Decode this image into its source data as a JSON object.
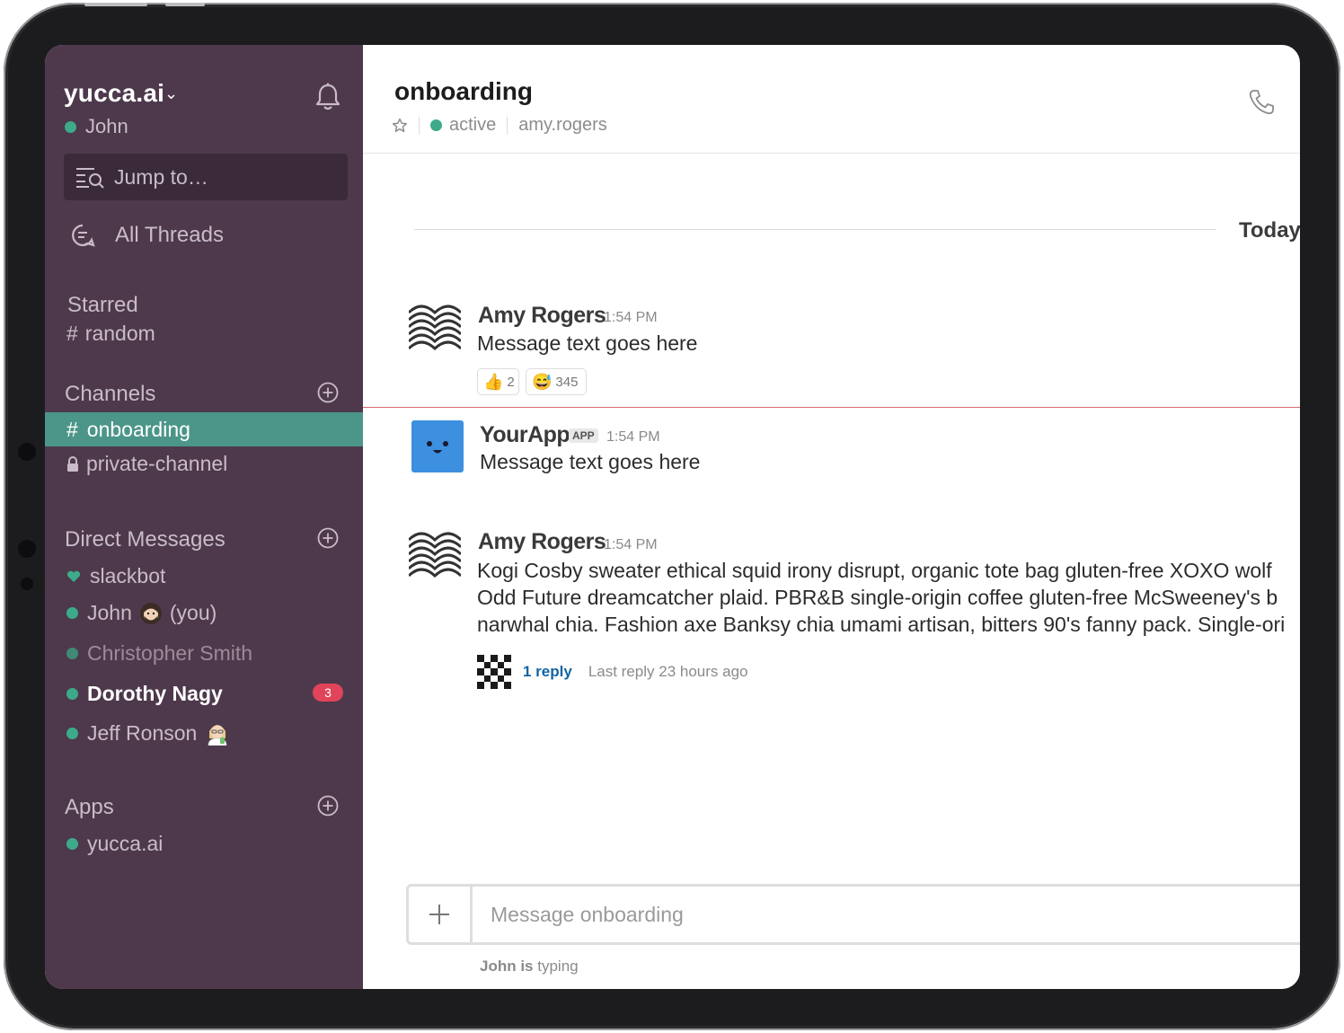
{
  "workspace": {
    "name": "yucca.ai",
    "user": "John"
  },
  "sidebar": {
    "jump_placeholder": "Jump to…",
    "all_threads": "All Threads",
    "starred": {
      "title": "Starred",
      "items": [
        {
          "label": "random"
        }
      ]
    },
    "channels": {
      "title": "Channels",
      "items": [
        {
          "label": "onboarding",
          "active": true
        },
        {
          "label": "private-channel",
          "private": true
        }
      ]
    },
    "direct_messages": {
      "title": "Direct Messages",
      "items": [
        {
          "label": "slackbot"
        },
        {
          "label": "John",
          "suffix": "(you)"
        },
        {
          "label": "Christopher Smith",
          "away": true
        },
        {
          "label": "Dorothy Nagy",
          "unread": "3"
        },
        {
          "label": "Jeff Ronson"
        }
      ]
    },
    "apps": {
      "title": "Apps",
      "items": [
        {
          "label": "yucca.ai"
        }
      ]
    }
  },
  "channel": {
    "title": "onboarding",
    "status": "active",
    "member": "amy.rogers",
    "date_divider": "Today"
  },
  "messages": [
    {
      "author": "Amy Rogers",
      "time": "1:54 PM",
      "text": "Message text goes here",
      "reactions": [
        {
          "emoji": "👍",
          "count": "2"
        },
        {
          "emoji": "😅",
          "count": "345"
        }
      ]
    },
    {
      "author": "YourApp",
      "tag": "APP",
      "time": "1:54 PM",
      "text": "Message text goes here"
    },
    {
      "author": "Amy Rogers",
      "time": "1:54 PM",
      "lines": [
        "Kogi Cosby sweater ethical squid irony disrupt, organic tote bag gluten-free XOXO wolf",
        "Odd Future dreamcatcher plaid. PBR&B single-origin coffee gluten-free McSweeney's b",
        "narwhal chia. Fashion axe Banksy chia umami artisan, bitters 90's fanny pack. Single-ori"
      ],
      "reply_count": "1 reply",
      "last_reply": "Last reply 23 hours ago"
    }
  ],
  "composer": {
    "placeholder": "Message onboarding",
    "typing_user": "John is",
    "typing_text": " typing"
  },
  "colors": {
    "sidebar": "#4d394b",
    "active_channel": "#4c9689",
    "presence": "#3daa8a",
    "badge": "#e0445a",
    "link": "#1264a3"
  }
}
